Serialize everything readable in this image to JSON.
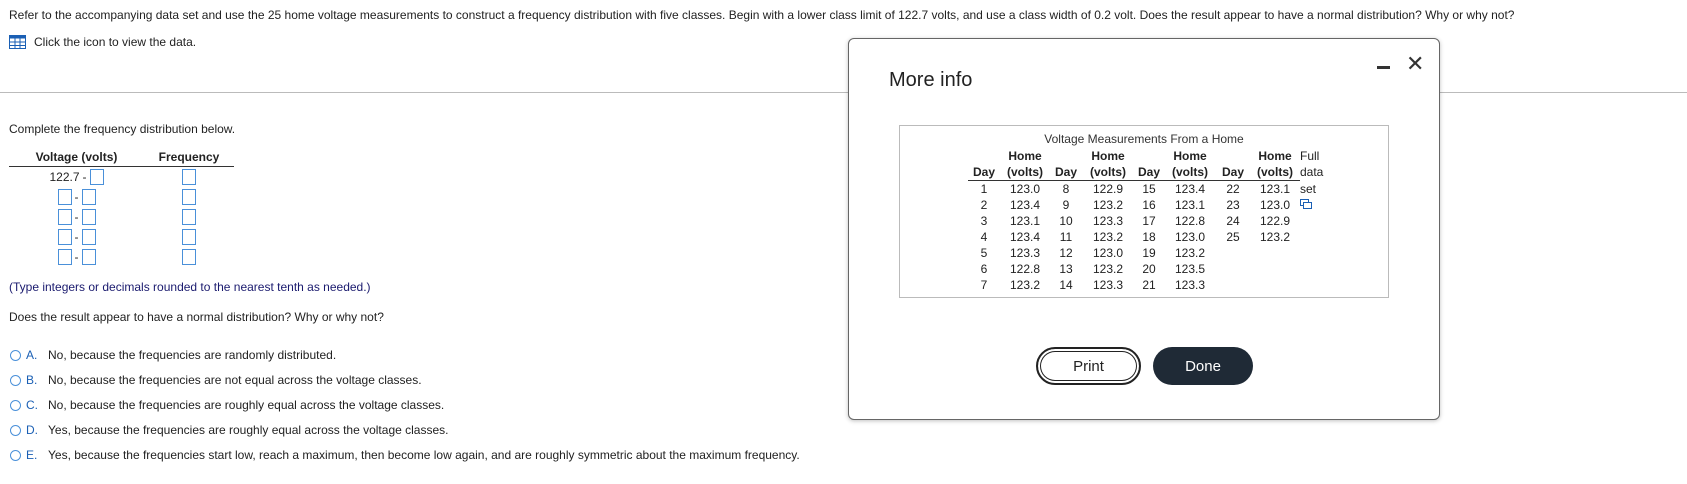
{
  "question": "Refer to the accompanying data set and use the 25 home voltage measurements to construct a frequency distribution with five classes. Begin with a lower class limit of 122.7 volts, and use a class width of 0.2 volt. Does the result appear to have a normal distribution? Why or why not?",
  "data_link": "Click the icon to view the data.",
  "instruction": "Complete the frequency distribution below.",
  "freq_table": {
    "col1": "Voltage (volts)",
    "col2": "Frequency",
    "first_lower": "122.7",
    "dash": "-"
  },
  "type_note": "(Type integers or decimals rounded to the nearest tenth as needed.)",
  "question2": "Does the result appear to have a normal distribution? Why or why not?",
  "options": [
    {
      "letter": "A.",
      "text": "No, because the frequencies are randomly distributed."
    },
    {
      "letter": "B.",
      "text": "No, because the frequencies are not equal across the voltage classes."
    },
    {
      "letter": "C.",
      "text": "No, because the frequencies are roughly equal across the voltage classes."
    },
    {
      "letter": "D.",
      "text": "Yes, because the frequencies are roughly equal across the voltage classes."
    },
    {
      "letter": "E.",
      "text": "Yes, because the frequencies start low, reach a maximum, then become low again, and are roughly symmetric about the maximum frequency."
    }
  ],
  "modal": {
    "title": "More info",
    "data_title": "Voltage Measurements From a Home",
    "header_top": [
      "",
      "Home",
      "",
      "Home",
      "",
      "Home",
      "",
      "Home"
    ],
    "header_bottom": [
      "Day",
      "(volts)",
      "Day",
      "(volts)",
      "Day",
      "(volts)",
      "Day",
      "(volts)"
    ],
    "full_set_label": [
      "Full",
      "data",
      "set"
    ],
    "rows": [
      [
        "1",
        "123.0",
        "8",
        "122.9",
        "15",
        "123.4",
        "22",
        "123.1"
      ],
      [
        "2",
        "123.4",
        "9",
        "123.2",
        "16",
        "123.1",
        "23",
        "123.0"
      ],
      [
        "3",
        "123.1",
        "10",
        "123.3",
        "17",
        "122.8",
        "24",
        "122.9"
      ],
      [
        "4",
        "123.4",
        "11",
        "123.2",
        "18",
        "123.0",
        "25",
        "123.2"
      ],
      [
        "5",
        "123.3",
        "12",
        "123.0",
        "19",
        "123.2",
        "",
        ""
      ],
      [
        "6",
        "122.8",
        "13",
        "123.2",
        "20",
        "123.5",
        "",
        ""
      ],
      [
        "7",
        "123.2",
        "14",
        "123.3",
        "21",
        "123.3",
        "",
        ""
      ]
    ],
    "print_label": "Print",
    "done_label": "Done"
  },
  "colors": {
    "accent": "#1a5fb4",
    "input_border": "#4a90d9",
    "done_bg": "#1f2a36"
  },
  "icons": {
    "data": "grid-icon",
    "copy": "copy-icon",
    "minimize": "minimize-icon",
    "close": "close-icon"
  }
}
